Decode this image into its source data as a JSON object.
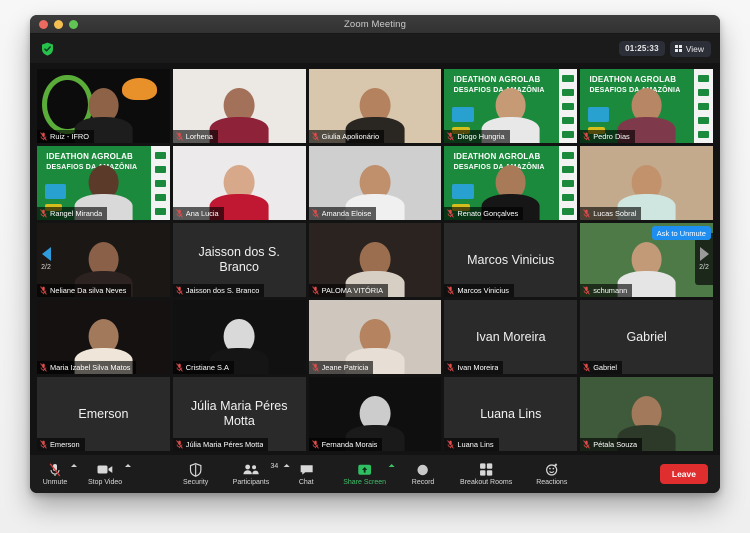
{
  "window": {
    "title": "Zoom Meeting",
    "traffic_lights": [
      "close",
      "minimize",
      "zoom"
    ]
  },
  "topbar": {
    "encryption_icon": "green-shield-check-icon",
    "timer": "01:25:33",
    "view_label": "View",
    "view_icon": "grid-icon"
  },
  "grid": {
    "page_indicator_left": "2/2",
    "page_indicator_right": "2/2",
    "ask_to_unmute_label": "Ask to Unmute",
    "rows": [
      [
        {
          "name": "Ruiz - IFRO",
          "video": true,
          "muted": true,
          "bg": "logo-dark",
          "skin": "#8d6247",
          "shirt": "#1d1d1d"
        },
        {
          "name": "Lorhena",
          "video": true,
          "muted": true,
          "bg": "#ece9e4",
          "skin": "#a3705a",
          "shirt": "#8e2239"
        },
        {
          "name": "Giulia Apolionário",
          "video": true,
          "muted": true,
          "bg": "#d8c7ad",
          "skin": "#b5825f",
          "shirt": "#2a2622"
        },
        {
          "name": "Diogo Hungria",
          "video": true,
          "muted": true,
          "bg": "slide",
          "skin": "#c79a76",
          "shirt": "#e8e8e8"
        },
        {
          "name": "Pedro Dias",
          "video": true,
          "muted": true,
          "bg": "slide",
          "skin": "#b78765",
          "shirt": "#7e3a4a"
        }
      ],
      [
        {
          "name": "Rangel Miranda",
          "video": true,
          "muted": true,
          "bg": "slide",
          "skin": "#5b3a2a",
          "shirt": "#d9d9d9"
        },
        {
          "name": "Ana Lucia",
          "video": true,
          "muted": true,
          "bg": "#eceaea",
          "skin": "#d7a98a",
          "shirt": "#c01832"
        },
        {
          "name": "Amanda Eloise",
          "video": true,
          "muted": true,
          "bg": "#cfcfcf",
          "skin": "#c08f6c",
          "shirt": "#f0f0f0"
        },
        {
          "name": "Renato Gonçalves",
          "video": true,
          "muted": true,
          "bg": "slide",
          "skin": "#a87a58",
          "shirt": "#161616"
        },
        {
          "name": "Lucas Sobral",
          "video": true,
          "muted": true,
          "bg": "#c4aa8c",
          "skin": "#c2926d",
          "shirt": "#cfe6e0"
        }
      ],
      [
        {
          "name": "Neliane Da silva Neves",
          "video": true,
          "muted": true,
          "bg": "#1a1714",
          "skin": "#8a6148",
          "shirt": "#2c2220"
        },
        {
          "name": "Jaisson dos S. Branco",
          "video": false,
          "muted": true
        },
        {
          "name": "PALOMA VITÓRIA",
          "video": true,
          "muted": true,
          "bg": "#2a2320",
          "skin": "#9c6e50",
          "shirt": "#d8cfc4"
        },
        {
          "name": "Marcos Vinicius",
          "video": false,
          "muted": true
        },
        {
          "name": "schumann",
          "video": true,
          "muted": true,
          "bg": "#4e7a47",
          "skin": "#c29a78",
          "shirt": "#e5e5e5",
          "ask_unmute": true
        }
      ],
      [
        {
          "name": "Maria Izabel Silva Matos",
          "video": true,
          "muted": true,
          "bg": "#141110",
          "skin": "#a3795c",
          "shirt": "#efe5d8"
        },
        {
          "name": "Cristiane S.A",
          "video": true,
          "muted": true,
          "bg": "#111111",
          "skin": "#d9d9d9",
          "shirt": "#151515"
        },
        {
          "name": "Jeane Patricia",
          "video": true,
          "muted": true,
          "bg": "#cfc6bd",
          "skin": "#b5835f",
          "shirt": "#e7dfd5"
        },
        {
          "name": "Ivan Moreira",
          "video": false,
          "muted": true
        },
        {
          "name": "Gabriel",
          "video": false,
          "muted": true
        }
      ],
      [
        {
          "name": "Emerson",
          "video": false,
          "muted": true
        },
        {
          "name": "Júlia Maria Péres Motta",
          "video": false,
          "muted": true
        },
        {
          "name": "Fernanda Morais",
          "video": true,
          "muted": true,
          "bg": "#0f0f0f",
          "skin": "#cccccc",
          "shirt": "#1a1a1a"
        },
        {
          "name": "Luana Lins",
          "video": false,
          "muted": true
        },
        {
          "name": "Pétala Souza",
          "video": true,
          "muted": true,
          "bg": "#3f5a3a",
          "skin": "#a3795c",
          "shirt": "#2d3a2a"
        }
      ]
    ]
  },
  "toolbar": {
    "unmute_label": "Unmute",
    "unmute_icon": "mic-muted-icon",
    "stop_video_label": "Stop Video",
    "stop_video_icon": "camera-icon",
    "security_label": "Security",
    "security_icon": "shield-icon",
    "participants_label": "Participants",
    "participants_icon": "people-icon",
    "participants_count": "34",
    "chat_label": "Chat",
    "chat_icon": "speech-bubble-icon",
    "share_screen_label": "Share Screen",
    "share_screen_icon": "share-screen-icon",
    "record_label": "Record",
    "record_icon": "record-circle-icon",
    "breakout_label": "Breakout Rooms",
    "breakout_icon": "squares-icon",
    "reactions_label": "Reactions",
    "reactions_icon": "reactions-icon",
    "leave_label": "Leave"
  },
  "colors": {
    "accent_blue": "#1f8ef1",
    "leave_red": "#e02d2d",
    "share_green": "#3fbf6a",
    "slide_green": "#1c8a3c"
  },
  "slide_text": {
    "line1": "IDEATHON AGROLAB",
    "line2": "DESAFIOS DA AMAZÔNIA"
  }
}
